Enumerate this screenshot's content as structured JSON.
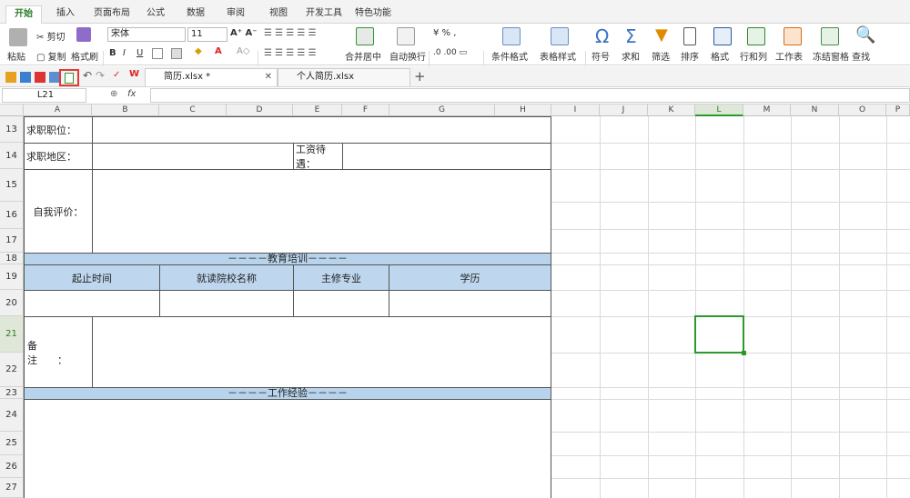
{
  "menu": {
    "tabs": [
      "开始",
      "插入",
      "页面布局",
      "公式",
      "数据",
      "审阅",
      "视图",
      "开发工具",
      "特色功能"
    ]
  },
  "ribbon": {
    "paste": "粘贴",
    "cut": "剪切",
    "copy": "复制",
    "format_painter": "格式刷",
    "font_name": "宋体",
    "font_size": "11",
    "bold": "B",
    "italic": "I",
    "underline": "U",
    "merge_center": "合并居中",
    "wrap_text": "自动换行",
    "percent": "%",
    "cond_format": "条件格式",
    "table_style": "表格样式",
    "symbol": "符号",
    "sum": "求和",
    "filter": "筛选",
    "sort": "排序",
    "format": "格式",
    "rows_cols": "行和列",
    "worksheet": "工作表",
    "freeze": "冻结窗格",
    "find": "查找"
  },
  "doc_tabs": [
    {
      "label": "简历.xlsx *"
    },
    {
      "label": "个人简历.xlsx"
    }
  ],
  "formula": {
    "cell_ref": "L21",
    "fx": "fx"
  },
  "columns": [
    "A",
    "B",
    "C",
    "D",
    "E",
    "F",
    "G",
    "H",
    "I",
    "J",
    "K",
    "L",
    "M",
    "N",
    "O",
    "P"
  ],
  "rows": [
    "13",
    "14",
    "15",
    "16",
    "17",
    "18",
    "19",
    "20",
    "21",
    "22",
    "23",
    "24",
    "25",
    "26",
    "27"
  ],
  "sheet": {
    "job_position": "求职职位：",
    "job_area": "求职地区：",
    "salary": "工资待遇：",
    "self_eval": "自我评价：",
    "edu_band": "－－－－教育培训－－－－",
    "edu_headers": [
      "起止时间",
      "就读院校名称",
      "主修专业",
      "学历"
    ],
    "remark": "备　　注　　：",
    "work_band": "－－－－工作经验－－－－"
  },
  "selected_cell": "L21",
  "colors": {
    "accent": "#2a9a2a",
    "header_fill": "#bed7ee",
    "band_fill": "#b8d4ed",
    "highlight": "#e53935"
  }
}
